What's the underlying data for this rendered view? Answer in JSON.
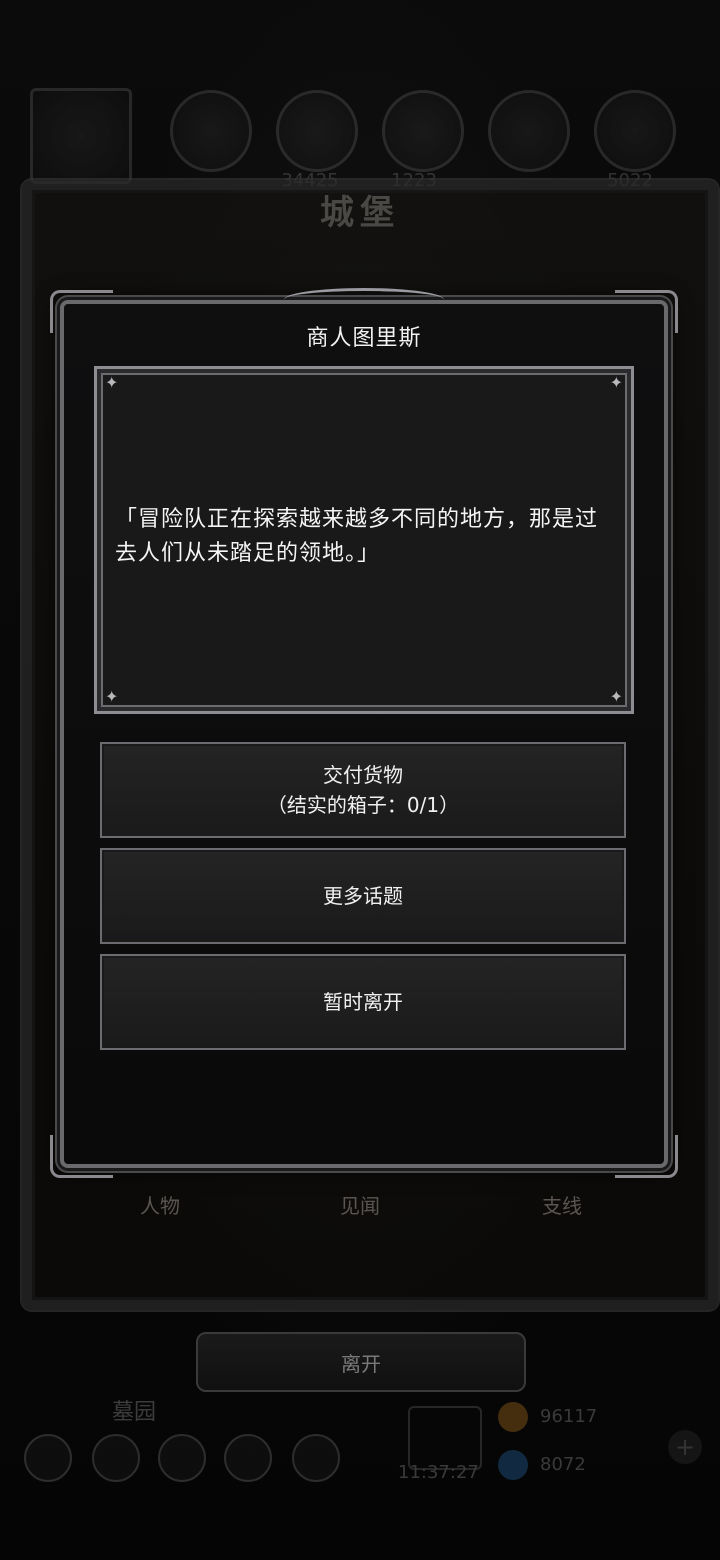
{
  "top_bar": {
    "values": [
      "34425",
      "1223",
      "5022"
    ]
  },
  "castle": {
    "title": "城堡",
    "tabs": [
      "人物",
      "见闻",
      "支线"
    ]
  },
  "dialog": {
    "title": "商人图里斯",
    "speech": "「冒险队正在探索越来越多不同的地方，那是过去人们从未踏足的领地。」",
    "options": [
      {
        "label": "交付货物",
        "sub": "（结实的箱子：0/1）"
      },
      {
        "label": "更多话题"
      },
      {
        "label": "暂时离开"
      }
    ]
  },
  "leave_button": "离开",
  "bottom_hud": {
    "location": "墓园",
    "clock": "11:37:27",
    "gold": "96117",
    "gems": "8072"
  },
  "icons": [
    "sword-icon",
    "orb-icon",
    "gift-icon",
    "coin-icon",
    "gem-icon",
    "plus-icon"
  ]
}
